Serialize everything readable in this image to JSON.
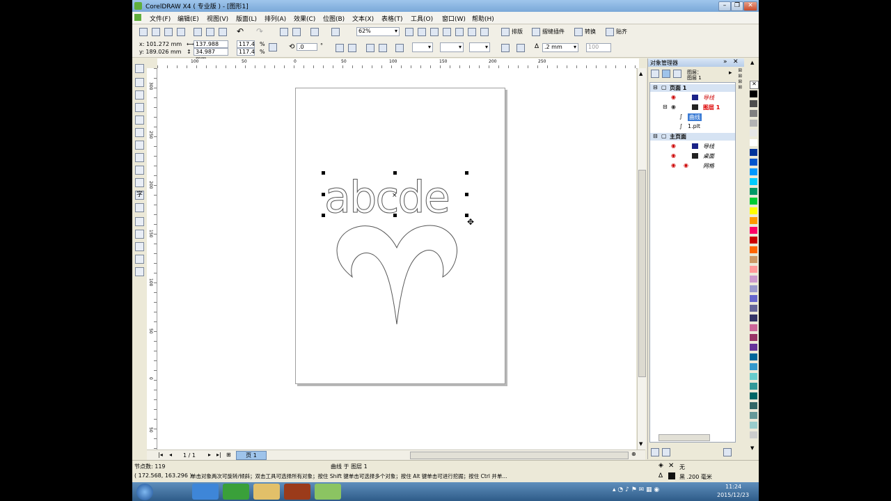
{
  "window": {
    "title": "CorelDRAW X4 ( 专业版 ) - [图形1]"
  },
  "menu": [
    "文件(F)",
    "编辑(E)",
    "视图(V)",
    "版面(L)",
    "排列(A)",
    "效果(C)",
    "位图(B)",
    "文本(X)",
    "表格(T)",
    "工具(O)",
    "窗口(W)",
    "帮助(H)"
  ],
  "toolbar": {
    "zoom": "62%",
    "buttons": [
      "排版",
      "摺缝插件",
      "转换",
      "贴齐"
    ]
  },
  "propbar": {
    "x": "x: 101.272 mm",
    "y": "y: 189.026 mm",
    "w": "137.988 mm",
    "h": "34.987 mm",
    "sx": "117.4",
    "sy": "117.4",
    "pct1": "%",
    "pct2": "%",
    "rotation": ".0",
    "deg": "°",
    "outline": ".2 mm",
    "hundred": "100"
  },
  "ruler": {
    "h": [
      "100",
      "50",
      "0",
      "50",
      "100",
      "150",
      "200",
      "250"
    ],
    "v": [
      "300",
      "250",
      "200",
      "150",
      "100",
      "50",
      "0",
      "50"
    ]
  },
  "pagenav": {
    "count": "1 / 1",
    "tab": "页 1"
  },
  "canvas_text": "abcde",
  "status": {
    "nodes": "节点数: 119",
    "selection": "曲线 于 图层 1",
    "coords": "( 172.568, 163.296 )",
    "hint": "单击对象两次可旋转/倾斜；双击工具可选择所有对象；按住 Shift 键单击可选择多个对象；按住 Alt 键单击可进行挖掘；按住 Ctrl 并单...",
    "fill": "无",
    "outline": "黑 .200 毫米"
  },
  "docker": {
    "title": "对象管理器",
    "header_label": "图层：",
    "header_value": "图层 1",
    "tree": [
      {
        "label": "页面 1",
        "kind": "page"
      },
      {
        "label": "导线",
        "kind": "layer"
      },
      {
        "label": "图层 1",
        "kind": "layer-active"
      },
      {
        "label": "曲线",
        "kind": "object-selected"
      },
      {
        "label": "1.plt",
        "kind": "object"
      },
      {
        "label": "主页面",
        "kind": "page"
      },
      {
        "label": "导线",
        "kind": "layer"
      },
      {
        "label": "桌面",
        "kind": "layer"
      },
      {
        "label": "网格",
        "kind": "layer"
      }
    ]
  },
  "palette": [
    "#000000",
    "#4d4d4d",
    "#808080",
    "#b3b3b3",
    "#e6e6e6",
    "#ffffff",
    "#003399",
    "#0055cc",
    "#0099ff",
    "#00ccff",
    "#009966",
    "#00cc33",
    "#ffff00",
    "#ff9900",
    "#ff0066",
    "#cc0000",
    "#ff6600",
    "#cc9966",
    "#ff9999",
    "#cc99cc",
    "#9999cc",
    "#6666cc",
    "#666699",
    "#333366",
    "#cc6699",
    "#993366",
    "#663399",
    "#006699",
    "#3399cc",
    "#66cccc",
    "#339999",
    "#006666",
    "#336666",
    "#669999",
    "#99cccc",
    "#cccccc"
  ],
  "taskbar": {
    "time": "11:24",
    "date": "2015/12/23"
  }
}
